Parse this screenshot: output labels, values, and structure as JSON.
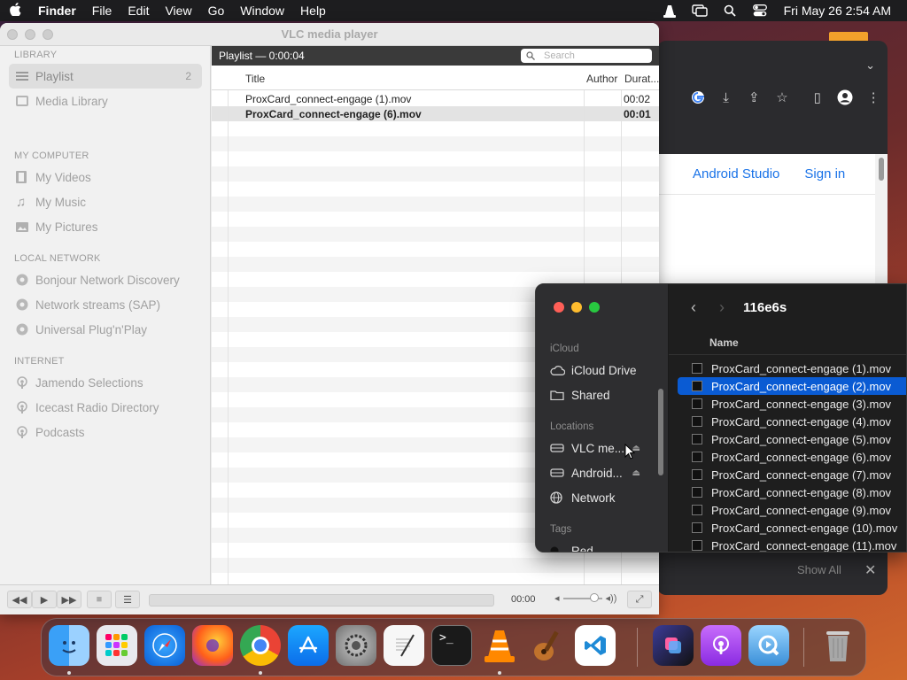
{
  "menubar": {
    "app_name": "Finder",
    "items": [
      "File",
      "Edit",
      "View",
      "Go",
      "Window",
      "Help"
    ],
    "clock": "Fri May 26  2:54 AM",
    "status_icons": [
      "vlc-cone-icon",
      "screen-mirroring-icon",
      "search-icon",
      "control-center-icon"
    ]
  },
  "vlc": {
    "window_title": "VLC media player",
    "sidebar": {
      "sections": [
        {
          "title": "LIBRARY",
          "items": [
            {
              "label": "Playlist",
              "count": "2",
              "icon": "playlist-icon"
            },
            {
              "label": "Media Library",
              "icon": "library-icon"
            }
          ]
        },
        {
          "title": "MY COMPUTER",
          "items": [
            {
              "label": "My Videos",
              "icon": "film-icon"
            },
            {
              "label": "My Music",
              "icon": "music-note-icon"
            },
            {
              "label": "My Pictures",
              "icon": "picture-icon"
            }
          ]
        },
        {
          "title": "LOCAL NETWORK",
          "items": [
            {
              "label": "Bonjour Network Discovery",
              "icon": "network-globe-icon"
            },
            {
              "label": "Network streams (SAP)",
              "icon": "network-globe-icon"
            },
            {
              "label": "Universal Plug'n'Play",
              "icon": "network-globe-icon"
            }
          ]
        },
        {
          "title": "INTERNET",
          "items": [
            {
              "label": "Jamendo Selections",
              "icon": "podcast-icon"
            },
            {
              "label": "Icecast Radio Directory",
              "icon": "podcast-icon"
            },
            {
              "label": "Podcasts",
              "icon": "podcast-icon"
            }
          ]
        }
      ]
    },
    "playlist": {
      "header": "Playlist — 0:00:04",
      "search_placeholder": "Search",
      "columns": {
        "title": "Title",
        "author": "Author",
        "duration": "Durat..."
      },
      "rows": [
        {
          "title": "ProxCard_connect-engage (1).mov",
          "author": "",
          "duration": "00:02",
          "bold": false
        },
        {
          "title": "ProxCard_connect-engage (6).mov",
          "author": "",
          "duration": "00:01",
          "bold": true
        }
      ]
    },
    "controls": {
      "time": "00:00",
      "volume_level": 0.7
    }
  },
  "chrome": {
    "links": [
      "Android Studio",
      "Sign in"
    ],
    "show_all": "Show All"
  },
  "finder": {
    "folder": "116e6s",
    "column_header": "Name",
    "sidebar": {
      "icloud_title": "iCloud",
      "icloud_items": [
        {
          "label": "iCloud Drive",
          "icon": "cloud-icon"
        },
        {
          "label": "Shared",
          "icon": "shared-folder-icon"
        }
      ],
      "locations_title": "Locations",
      "location_items": [
        {
          "label": "VLC me...",
          "icon": "disk-icon",
          "eject": true
        },
        {
          "label": "Android...",
          "icon": "disk-icon",
          "eject": true
        },
        {
          "label": "Network",
          "icon": "network-globe-icon",
          "eject": false
        }
      ],
      "tags_title": "Tags",
      "tag_items": [
        {
          "label": "Red",
          "color": "#e0443e"
        }
      ]
    },
    "files": [
      "ProxCard_connect-engage (1).mov",
      "ProxCard_connect-engage (2).mov",
      "ProxCard_connect-engage (3).mov",
      "ProxCard_connect-engage (4).mov",
      "ProxCard_connect-engage (5).mov",
      "ProxCard_connect-engage (6).mov",
      "ProxCard_connect-engage (7).mov",
      "ProxCard_connect-engage (8).mov",
      "ProxCard_connect-engage (9).mov",
      "ProxCard_connect-engage (10).mov",
      "ProxCard_connect-engage (11).mov"
    ],
    "selected_index": 1
  },
  "dock": {
    "apps": [
      "finder-icon",
      "launchpad-icon",
      "safari-icon",
      "firefox-icon",
      "chrome-icon",
      "app-store-icon",
      "system-settings-icon",
      "textedit-icon",
      "terminal-icon",
      "vlc-icon",
      "garageband-icon",
      "vscode-icon",
      "shortcuts-icon",
      "podcasts-icon",
      "quicktime-icon",
      "trash-icon"
    ]
  }
}
